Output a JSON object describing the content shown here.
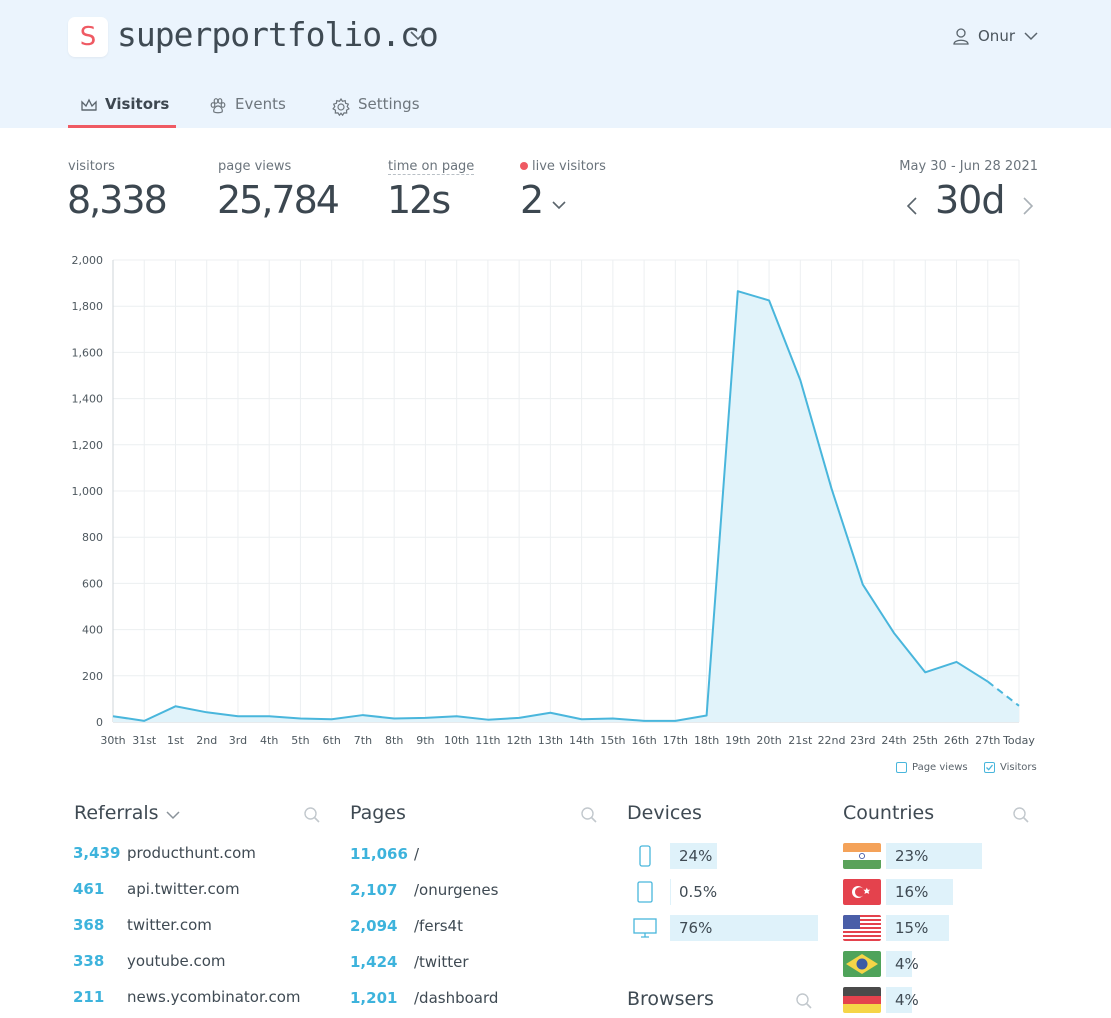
{
  "header": {
    "logo_letter": "S",
    "site_name": "superportfolio.co",
    "user_name": "Onur",
    "tabs": [
      {
        "label": "Visitors",
        "active": true,
        "icon": "crown-icon"
      },
      {
        "label": "Events",
        "active": false,
        "icon": "paw-icon"
      },
      {
        "label": "Settings",
        "active": false,
        "icon": "gear-icon"
      }
    ]
  },
  "stats": {
    "visitors_label": "visitors",
    "visitors_value": "8,338",
    "pageviews_label": "page views",
    "pageviews_value": "25,784",
    "time_label": "time on page",
    "time_value": "12s",
    "live_label": "live visitors",
    "live_value": "2",
    "date_range": "May 30 - Jun 28 2021",
    "period": "30d"
  },
  "colors": {
    "accent": "#ef5a63",
    "line": "#49b6dc",
    "area": "#e1f3fa",
    "header_bg": "#ebf4fd"
  },
  "chart_data": {
    "type": "area",
    "categories": [
      "30th",
      "31st",
      "1st",
      "2nd",
      "3rd",
      "4th",
      "5th",
      "6th",
      "7th",
      "8th",
      "9th",
      "10th",
      "11th",
      "12th",
      "13th",
      "14th",
      "15th",
      "16th",
      "17th",
      "18th",
      "19th",
      "20th",
      "21st",
      "22nd",
      "23rd",
      "24th",
      "25th",
      "26th",
      "27th",
      "Today"
    ],
    "series": [
      {
        "name": "Visitors",
        "values": [
          25,
          5,
          68,
          42,
          25,
          25,
          15,
          12,
          30,
          15,
          18,
          25,
          10,
          18,
          40,
          12,
          15,
          5,
          5,
          28,
          1865,
          1825,
          1480,
          1010,
          595,
          385,
          215,
          260,
          175,
          70
        ]
      }
    ],
    "ylim": [
      0,
      2000
    ],
    "yticks": [
      "0",
      "200",
      "400",
      "600",
      "800",
      "1,000",
      "1,200",
      "1,400",
      "1,600",
      "1,800",
      "2,000"
    ],
    "grid": true,
    "legend": [
      {
        "label": "Page views",
        "checked": false
      },
      {
        "label": "Visitors",
        "checked": true
      }
    ],
    "legend_position": "bottom-right"
  },
  "referrals": {
    "title": "Referrals",
    "items": [
      {
        "count": "3,439",
        "source": "producthunt.com"
      },
      {
        "count": "461",
        "source": "api.twitter.com"
      },
      {
        "count": "368",
        "source": "twitter.com"
      },
      {
        "count": "338",
        "source": "youtube.com"
      },
      {
        "count": "211",
        "source": "news.ycombinator.com"
      }
    ]
  },
  "pages": {
    "title": "Pages",
    "items": [
      {
        "count": "11,066",
        "path": "/"
      },
      {
        "count": "2,107",
        "path": "/onurgenes"
      },
      {
        "count": "2,094",
        "path": "/fers4t"
      },
      {
        "count": "1,424",
        "path": "/twitter"
      },
      {
        "count": "1,201",
        "path": "/dashboard"
      }
    ]
  },
  "devices": {
    "title": "Devices",
    "items": [
      {
        "icon": "phone-icon",
        "pct": "24%",
        "fraction": 0.24
      },
      {
        "icon": "tablet-icon",
        "pct": "0.5%",
        "fraction": 0.005
      },
      {
        "icon": "desktop-icon",
        "pct": "76%",
        "fraction": 0.76
      }
    ]
  },
  "browsers": {
    "title": "Browsers"
  },
  "countries": {
    "title": "Countries",
    "items": [
      {
        "flag": "india-flag-icon",
        "pct": "23%",
        "fraction": 0.23
      },
      {
        "flag": "turkey-flag-icon",
        "pct": "16%",
        "fraction": 0.16
      },
      {
        "flag": "usa-flag-icon",
        "pct": "15%",
        "fraction": 0.15
      },
      {
        "flag": "brazil-flag-icon",
        "pct": "4%",
        "fraction": 0.04
      },
      {
        "flag": "germany-flag-icon",
        "pct": "4%",
        "fraction": 0.04
      }
    ]
  }
}
